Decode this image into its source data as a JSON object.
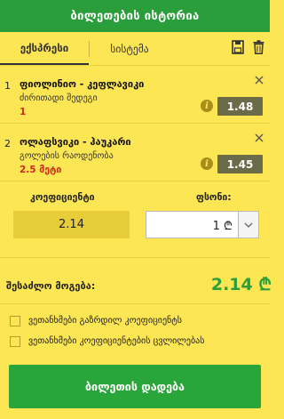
{
  "header": {
    "title": "ბილეთების ისტორია"
  },
  "tabs": [
    {
      "label": "ექსპრესი"
    },
    {
      "label": "სისტემა"
    }
  ],
  "icons": {
    "save": "save-icon",
    "delete": "trash-icon",
    "close": "close-icon",
    "info": "info-icon",
    "currency": "lari-icon",
    "dropdown": "chevron-down-icon"
  },
  "bets": [
    {
      "num": "1",
      "title": "ფიოლინიო - კეფლავიკი",
      "market": "ძირითადი შედეგი",
      "pick": "1",
      "odd": "1.48"
    },
    {
      "num": "2",
      "title": "ოლაფსვიკი - ჰაუკარი",
      "market": "გოლების რაოდენობა",
      "pick": "2.5 მეტი",
      "odd": "1.45"
    }
  ],
  "summary": {
    "coef_label": "კოეფიციენტი",
    "coef_value": "2.14",
    "stake_label": "ფსონი:",
    "stake_value": "1 ₾",
    "win_label": "შესაძლო მოგება:",
    "win_value": "2.14 ₾"
  },
  "options": [
    {
      "label": "ვეთანხმები გაზრდილ კოეფიციენტს"
    },
    {
      "label": "ვეთანხმები კოეფიციენტების ცვლილებას"
    }
  ],
  "place_button": "ბილეთის დადება",
  "colors": {
    "header_bg": "#2a9e3a",
    "panel_bg": "#fde653",
    "odd_bg": "#6b6b4a",
    "pick": "#d0261c",
    "win": "#2a9e3a",
    "button": "#2aa53a"
  }
}
